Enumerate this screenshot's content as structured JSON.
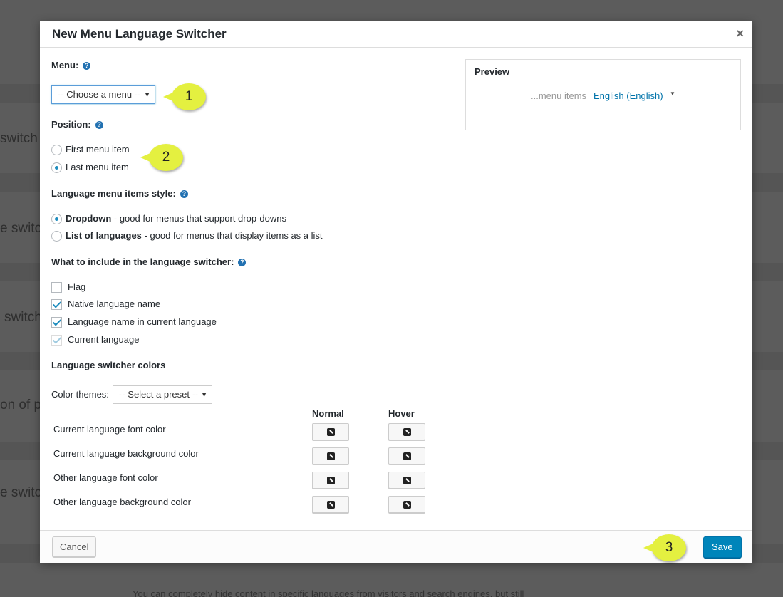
{
  "background": {
    "fragments": [
      "switch",
      "e switc",
      "switch",
      "on of p",
      "e switc"
    ],
    "bottom_text": "You can completely hide content in specific languages from visitors and search engines, but still"
  },
  "modal": {
    "title": "New Menu Language Switcher",
    "close_label": "×"
  },
  "menu": {
    "label": "Menu:",
    "selected": "-- Choose a menu --"
  },
  "position": {
    "label": "Position:",
    "options": [
      {
        "label": "First menu item",
        "checked": false
      },
      {
        "label": "Last menu item",
        "checked": true
      }
    ]
  },
  "style": {
    "label": "Language menu items style:",
    "options": [
      {
        "title": "Dropdown",
        "desc": " - good for menus that support drop-downs",
        "checked": true
      },
      {
        "title": "List of languages",
        "desc": " - good for menus that display items as a list",
        "checked": false
      }
    ]
  },
  "include": {
    "label": "What to include in the language switcher:",
    "options": [
      {
        "label": "Flag",
        "checked": false
      },
      {
        "label": "Native language name",
        "checked": true
      },
      {
        "label": "Language name in current language",
        "checked": true
      },
      {
        "label": "Current language",
        "checked": true,
        "disabled": true
      }
    ]
  },
  "colors": {
    "label": "Language switcher colors",
    "themes_label": "Color themes:",
    "themes_selected": "-- Select a preset --",
    "col_normal": "Normal",
    "col_hover": "Hover",
    "rows": [
      "Current language font color",
      "Current language background color",
      "Other language font color",
      "Other language background color"
    ]
  },
  "preview": {
    "title": "Preview",
    "menu_items": "...menu items",
    "language": "English (English)"
  },
  "footer": {
    "cancel_label": "Cancel",
    "save_label": "Save"
  },
  "callouts": [
    "1",
    "2",
    "3"
  ],
  "help_icon": "?",
  "colors_theme": {
    "accent": "#0085ba",
    "callout": "#e4f040",
    "link": "#0073aa"
  }
}
